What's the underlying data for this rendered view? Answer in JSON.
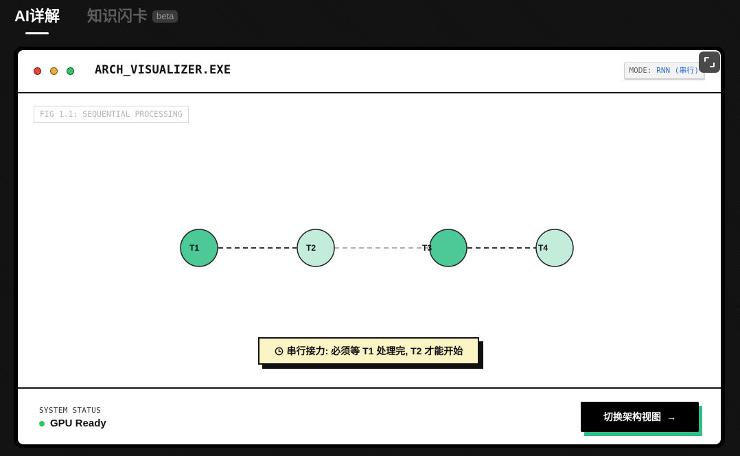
{
  "tabs": {
    "ai_detail": "AI详解",
    "flash_cards": "知识闪卡",
    "flash_cards_badge": "beta"
  },
  "window": {
    "title": "ARCH_VISUALIZER.EXE",
    "mode_label": "MODE:",
    "mode_value": "RNN (串行)"
  },
  "figure": {
    "label": "FIG 1.1: SEQUENTIAL PROCESSING"
  },
  "nodes": [
    {
      "label": "T1",
      "state": "active",
      "fill": "#4cc997"
    },
    {
      "label": "T2",
      "state": "pending",
      "fill": "#c4ecdb"
    },
    {
      "label": "T3",
      "state": "active",
      "fill": "#4cc997"
    },
    {
      "label": "T4",
      "state": "pending",
      "fill": "#c4ecdb"
    }
  ],
  "tip": {
    "text": "串行接力: 必须等 T1 处理完, T2 才能开始",
    "icon": "clock-icon"
  },
  "footer": {
    "status_label": "SYSTEM STATUS",
    "status_value": "GPU Ready",
    "switch_button": "切换架构视图",
    "switch_icon": "arrow-right-icon"
  },
  "colors": {
    "accent_green": "#2fbf86",
    "status_green": "#2fc467",
    "mode_blue": "#2f6fd6",
    "tip_background": "#fbf4c4"
  }
}
